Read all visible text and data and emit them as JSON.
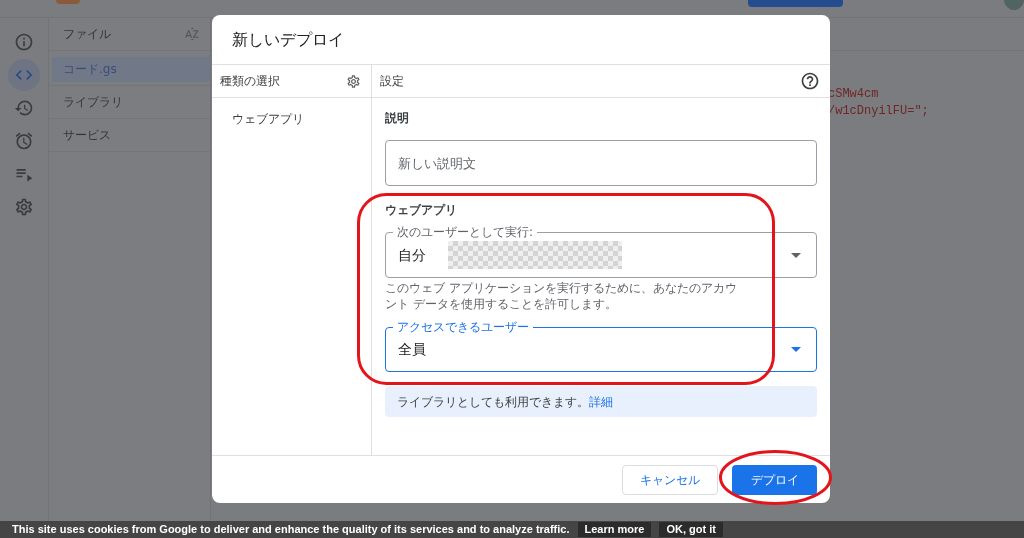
{
  "icon_rail": {
    "items": [
      {
        "kind": "info",
        "selected": false
      },
      {
        "kind": "code",
        "selected": true
      },
      {
        "kind": "history",
        "selected": false
      },
      {
        "kind": "triggers",
        "selected": false
      },
      {
        "kind": "executions",
        "selected": false
      },
      {
        "kind": "settings",
        "selected": false
      }
    ]
  },
  "files_panel": {
    "sections": [
      {
        "title": "ファイル",
        "sortable": true,
        "files": [
          {
            "name": "コード.gs",
            "selected": true
          }
        ]
      },
      {
        "title": "ライブラリ",
        "sortable": false
      },
      {
        "title": "サービス",
        "sortable": false
      }
    ]
  },
  "editor": {
    "code_lines": [
      "cSMw4cm",
      "/w1cDnyilFU=\";"
    ]
  },
  "dialog": {
    "title": "新しいデプロイ",
    "type_column": {
      "heading": "種類の選択",
      "types": [
        {
          "label": "ウェブアプリ",
          "selected": false
        }
      ]
    },
    "settings_column": {
      "heading": "設定",
      "description": {
        "label": "説明",
        "placeholder": "新しい説明文"
      },
      "section_title": "ウェブアプリ",
      "execute_as": {
        "label": "次のユーザーとして実行:",
        "value": "自分",
        "focused": false
      },
      "execute_as_note": "このウェブ アプリケーションを実行するために、あなたのアカウント データを使用することを許可します。",
      "access": {
        "label": "アクセスできるユーザー",
        "value": "全員",
        "focused": true
      },
      "notice": {
        "text": "ライブラリとしても利用できます。",
        "link": "詳細"
      }
    },
    "buttons": [
      {
        "label": "キャンセル",
        "kind": "secondary"
      },
      {
        "label": "デプロイ",
        "kind": "primary"
      }
    ]
  },
  "cookie_bar": {
    "message": "This site uses cookies from Google to deliver and enhance the quality of its services and to analyze traffic.",
    "buttons": [
      "Learn more",
      "OK, got it"
    ]
  }
}
